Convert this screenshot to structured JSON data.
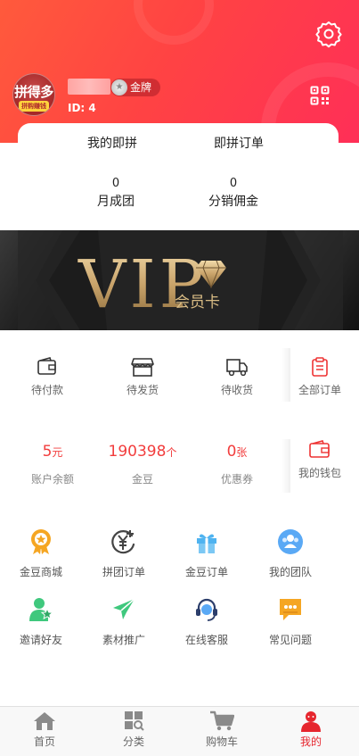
{
  "profile": {
    "avatar_text": "拼得多",
    "avatar_subtext": "拼购赚钱",
    "level": "金牌",
    "id_text": "ID: 4"
  },
  "card_tabs": [
    "我的即拼",
    "即拼订单"
  ],
  "stats": [
    {
      "value": "0",
      "label": "月成团"
    },
    {
      "value": "0",
      "label": "分销佣金"
    }
  ],
  "vip": {
    "title": "VIP",
    "subtitle": "会员卡"
  },
  "orders": [
    {
      "icon": "wallet-icon",
      "label": "待付款"
    },
    {
      "icon": "shop-icon",
      "label": "待发货"
    },
    {
      "icon": "truck-icon",
      "label": "待收货"
    },
    {
      "icon": "clipboard-icon",
      "label": "全部订单"
    }
  ],
  "assets": [
    {
      "value": "5",
      "unit": "元",
      "label": "账户余额"
    },
    {
      "value": "190398",
      "unit": "个",
      "label": "金豆"
    },
    {
      "value": "0",
      "unit": "张",
      "label": "优惠券"
    },
    {
      "icon": "wallet-icon",
      "label": "我的钱包"
    }
  ],
  "tools": [
    {
      "icon": "medal-icon",
      "label": "金豆商城",
      "color": "#f5a623"
    },
    {
      "icon": "yen-icon",
      "label": "拼团订单",
      "color": "#444444"
    },
    {
      "icon": "gift-icon",
      "label": "金豆订单",
      "color": "#4fb3f0"
    },
    {
      "icon": "team-icon",
      "label": "我的团队",
      "color": "#5aa9f5"
    },
    {
      "icon": "invite-icon",
      "label": "邀请好友",
      "color": "#3fc87d"
    },
    {
      "icon": "send-icon",
      "label": "素材推广",
      "color": "#3fc87d"
    },
    {
      "icon": "headset-icon",
      "label": "在线客服",
      "color": "#2c3e6b"
    },
    {
      "icon": "chat-icon",
      "label": "常见问题",
      "color": "#f5a623"
    }
  ],
  "tabbar": [
    {
      "icon": "home-icon",
      "label": "首页",
      "active": false
    },
    {
      "icon": "category-icon",
      "label": "分类",
      "active": false
    },
    {
      "icon": "cart-icon",
      "label": "购物车",
      "active": false
    },
    {
      "icon": "profile-icon",
      "label": "我的",
      "active": true
    }
  ],
  "colors": {
    "accent": "#e6262e",
    "header_start": "#ff5a3c",
    "header_end": "#ff2f57",
    "price_red": "#f23d3d"
  }
}
